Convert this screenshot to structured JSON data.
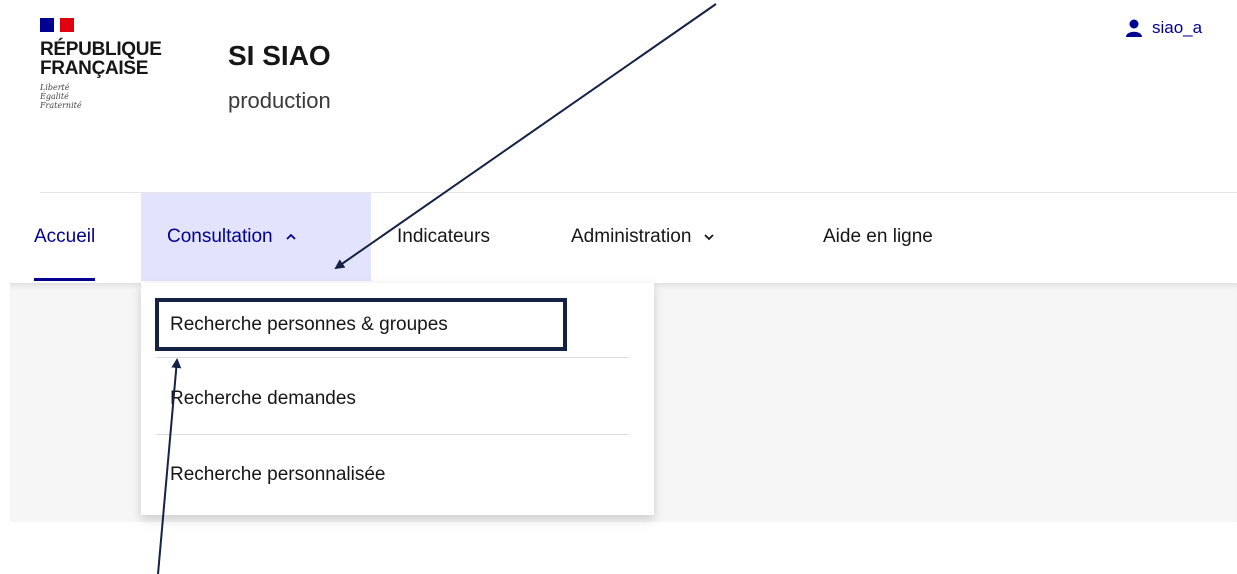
{
  "header": {
    "brand_line1": "République",
    "brand_line2": "Française",
    "motto": [
      "Liberté",
      "Égalité",
      "Fraternité"
    ],
    "site_title": "SI SIAO",
    "site_subtitle": "production",
    "user_name": "siao_a"
  },
  "nav": {
    "items": [
      {
        "label": "Accueil"
      },
      {
        "label": "Consultation"
      },
      {
        "label": "Indicateurs"
      },
      {
        "label": "Administration"
      },
      {
        "label": "Aide en ligne"
      }
    ]
  },
  "dropdown": {
    "items": [
      {
        "label": "Recherche personnes & groupes"
      },
      {
        "label": "Recherche demandes"
      },
      {
        "label": "Recherche personnalisée"
      }
    ]
  },
  "colors": {
    "primary_blue": "#000091",
    "open_menu_bg": "#e3e3fd",
    "flag_red": "#e1000f",
    "annotation": "#152244"
  },
  "icons": [
    "user-icon",
    "chevron-up-icon",
    "chevron-down-icon"
  ]
}
